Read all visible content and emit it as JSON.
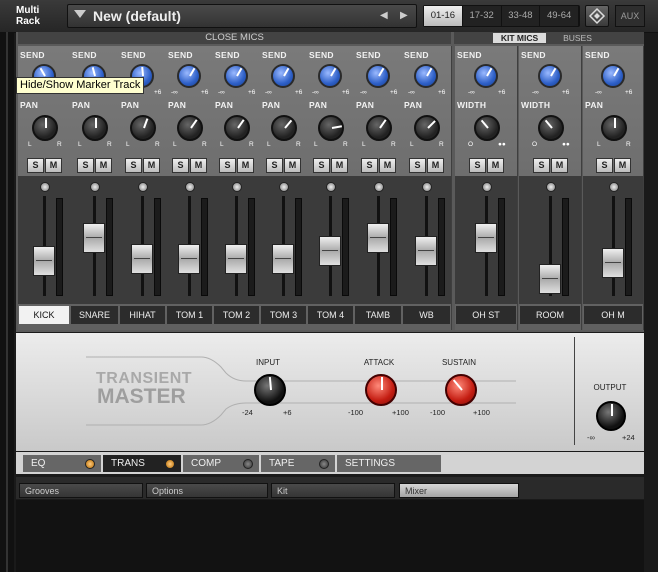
{
  "topbar": {
    "rack_label": "Multi Rack",
    "preset_name": "New (default)",
    "range_tabs": [
      "01-16",
      "17-32",
      "33-48",
      "49-64"
    ],
    "selected_range": "01-16",
    "aux_label": "AUX"
  },
  "mixer": {
    "close_mics_header": "CLOSE MICS",
    "kit_mics_tab": "KIT MICS",
    "buses_tab": "BUSES",
    "close_channels": [
      {
        "name": "KICK",
        "selected": true,
        "send": "SEND",
        "pan": "PAN",
        "fader": 0.3
      },
      {
        "name": "SNARE",
        "send": "SEND",
        "pan": "PAN",
        "fader": 0.62
      },
      {
        "name": "HIHAT",
        "send": "SEND",
        "pan": "PAN",
        "fader": 0.33
      },
      {
        "name": "TOM 1",
        "send": "SEND",
        "pan": "PAN",
        "fader": 0.33
      },
      {
        "name": "TOM 2",
        "send": "SEND",
        "pan": "PAN",
        "fader": 0.33
      },
      {
        "name": "TOM 3",
        "send": "SEND",
        "pan": "PAN",
        "fader": 0.33
      },
      {
        "name": "TOM 4",
        "send": "SEND",
        "pan": "PAN",
        "fader": 0.45
      },
      {
        "name": "TAMB",
        "send": "SEND",
        "pan": "PAN",
        "fader": 0.62
      },
      {
        "name": "WB",
        "send": "SEND",
        "pan": "PAN",
        "fader": 0.45
      }
    ],
    "kit_channels": [
      {
        "name": "OH ST",
        "send": "SEND",
        "second": "WIDTH",
        "fader": 0.62
      },
      {
        "name": "ROOM",
        "send": "SEND",
        "second": "WIDTH",
        "fader": 0.05
      },
      {
        "name": "OH M",
        "send": "SEND",
        "second": "PAN",
        "fader": 0.28
      }
    ],
    "send_min": "-∞",
    "send_max": "+6",
    "pan_left": "L",
    "pan_right": "R",
    "width_min": "O",
    "solo_label": "S",
    "mute_label": "M"
  },
  "tooltip": "Hide/Show Marker Track",
  "transient_master": {
    "title_line1": "TRANSIENT",
    "title_line2": "MASTER",
    "input": {
      "label": "INPUT",
      "min": "-24",
      "max": "+6"
    },
    "attack": {
      "label": "ATTACK",
      "min": "-100",
      "max": "+100"
    },
    "sustain": {
      "label": "SUSTAIN",
      "min": "-100",
      "max": "+100"
    },
    "output": {
      "label": "OUTPUT",
      "min": "-∞",
      "max": "+24"
    }
  },
  "fx_tabs": [
    {
      "label": "EQ",
      "led": "on"
    },
    {
      "label": "TRANS",
      "led": "on",
      "selected": true
    },
    {
      "label": "COMP",
      "led": "off"
    },
    {
      "label": "TAPE",
      "led": "off"
    },
    {
      "label": "SETTINGS"
    }
  ],
  "bottom_tabs": [
    "Grooves",
    "Options",
    "Kit",
    "Mixer"
  ],
  "selected_bottom_tab": "Mixer"
}
